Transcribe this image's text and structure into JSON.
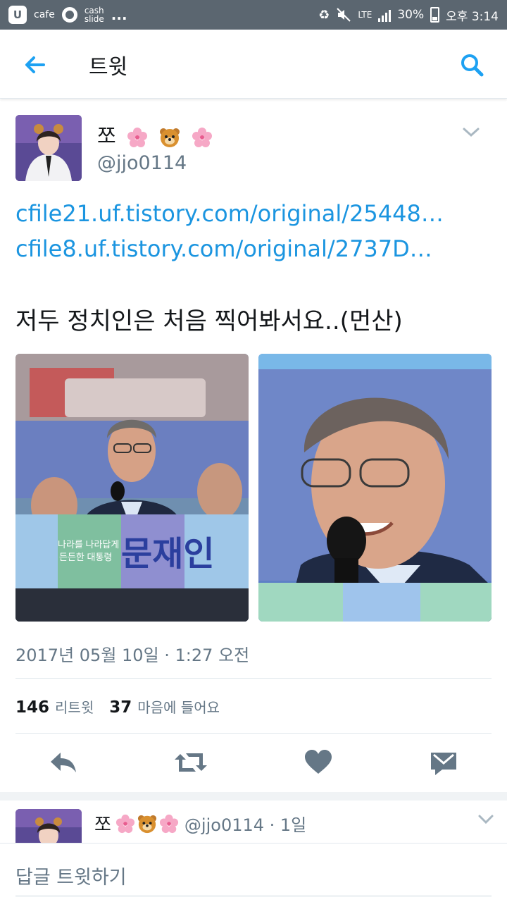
{
  "status_bar": {
    "app1": "cafe",
    "app2_line1": "cash",
    "app2_line2": "slide",
    "more": "...",
    "network": "LTE",
    "battery": "30%",
    "time": "오후 3:14"
  },
  "app_bar": {
    "title": "트윗",
    "back_icon": "arrow-left-icon",
    "search_icon": "search-icon"
  },
  "tweet": {
    "author_name": "쪼",
    "author_emoji": [
      "cherry-blossom",
      "bear-face",
      "cherry-blossom"
    ],
    "handle": "@jjo0114",
    "links": [
      "cfile21.uf.tistory.com/original/25448…",
      "cfile8.uf.tistory.com/original/2737D…"
    ],
    "text": "저두 정치인은 처음 찍어봐서요..(먼산)",
    "photo_banner_text": "문재인",
    "photo_banner_small": [
      "나라를 나라답게",
      "든든한 대통령"
    ],
    "timestamp": "2017년 05월 10일 · 1:27 오전",
    "retweet_count": "146",
    "retweet_label": "리트윗",
    "like_count": "37",
    "like_label": "마음에 들어요"
  },
  "actions": [
    "reply-icon",
    "retweet-icon",
    "heart-icon",
    "message-icon"
  ],
  "reply": {
    "author_name": "쪼",
    "meta": "@jjo0114 · 1일"
  },
  "compose": {
    "placeholder": "답글 트윗하기"
  },
  "colors": {
    "status_bar": "#5b6670",
    "link": "#1b95e0",
    "icon_blue": "#1da1f2",
    "secondary_text": "#657786",
    "action_icon": "#657786"
  }
}
